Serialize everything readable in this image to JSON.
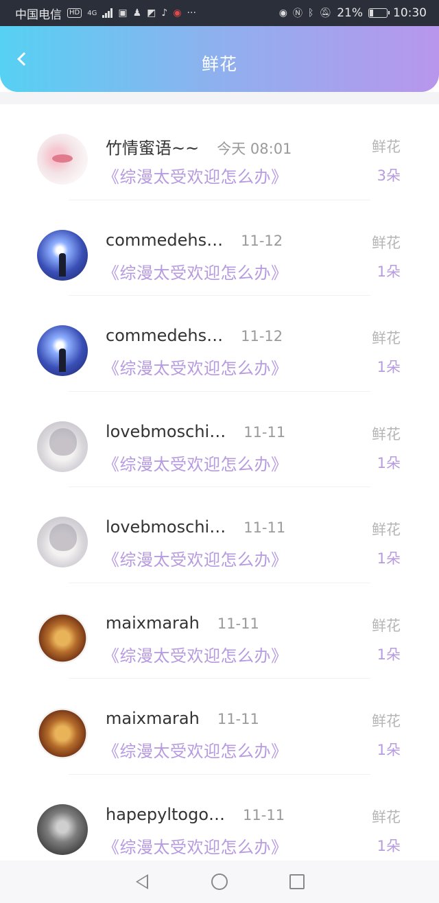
{
  "status_bar": {
    "carrier": "中国电信",
    "hd": "HD",
    "network": "4G",
    "battery_percent": "21%",
    "battery_level": 0.21,
    "time": "10:30",
    "more": "···"
  },
  "header": {
    "title": "鲜花"
  },
  "list": [
    {
      "user": "竹情蜜语~~",
      "time": "今天 08:01",
      "book": "《综漫太受欢迎怎么办》",
      "gift": "鲜花",
      "count": "3朵",
      "avatar": "lips-avatar"
    },
    {
      "user": "commedehs…",
      "time": "11-12",
      "book": "《综漫太受欢迎怎么办》",
      "gift": "鲜花",
      "count": "1朵",
      "avatar": "sky-avatar"
    },
    {
      "user": "commedehs…",
      "time": "11-12",
      "book": "《综漫太受欢迎怎么办》",
      "gift": "鲜花",
      "count": "1朵",
      "avatar": "sky-avatar"
    },
    {
      "user": "lovebmoschi…",
      "time": "11-11",
      "book": "《综漫太受欢迎怎么办》",
      "gift": "鲜花",
      "count": "1朵",
      "avatar": "anime-avatar"
    },
    {
      "user": "lovebmoschi…",
      "time": "11-11",
      "book": "《综漫太受欢迎怎么办》",
      "gift": "鲜花",
      "count": "1朵",
      "avatar": "anime-avatar"
    },
    {
      "user": "maixmarah",
      "time": "11-11",
      "book": "《综漫太受欢迎怎么办》",
      "gift": "鲜花",
      "count": "1朵",
      "avatar": "food-avatar"
    },
    {
      "user": "maixmarah",
      "time": "11-11",
      "book": "《综漫太受欢迎怎么办》",
      "gift": "鲜花",
      "count": "1朵",
      "avatar": "food-avatar"
    },
    {
      "user": "hapepyltogo…",
      "time": "11-11",
      "book": "《综漫太受欢迎怎么办》",
      "gift": "鲜花",
      "count": "1朵",
      "avatar": "photo-avatar"
    }
  ],
  "colors": {
    "header_gradient_start": "#56d1f3",
    "header_gradient_end": "#b896ec",
    "accent_purple": "#b79be0",
    "muted_gray": "#9a9a9a"
  }
}
